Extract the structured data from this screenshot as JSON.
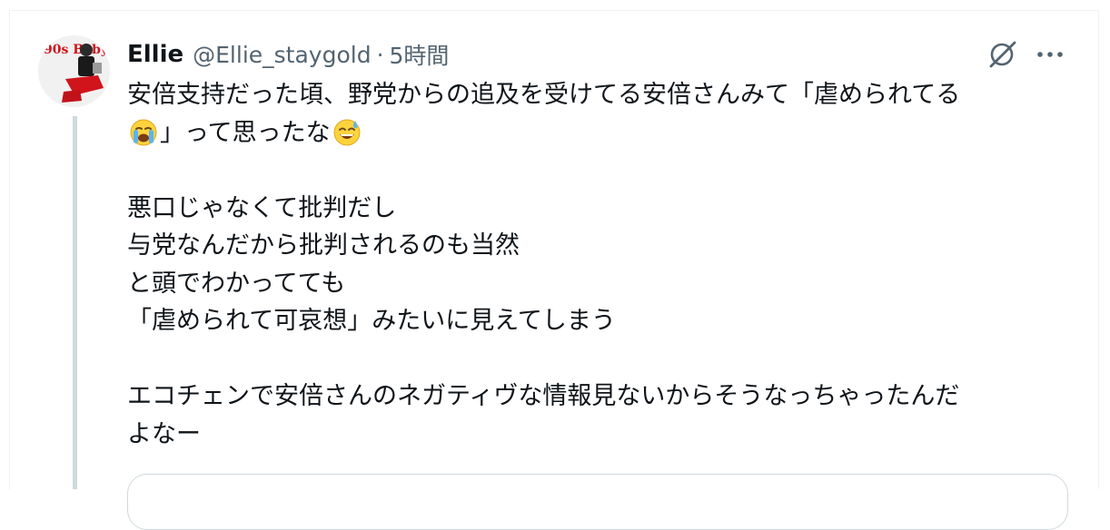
{
  "tweet": {
    "avatar_label": "90s Baby",
    "author_name": "Ellie",
    "handle": "@Ellie_staygold",
    "separator": "·",
    "time": "5時間",
    "line1": "安倍支持だった頃、野党からの追及を受けてる安倍さんみて「虐められてる",
    "line2": "」って思ったな",
    "line3": "悪口じゃなくて批判だし",
    "line4": "与党なんだから批判されるのも当然",
    "line5": "と頭でわかってても",
    "line6": "「虐められて可哀想」みたいに見えてしまう",
    "line7": "エコチェンで安倍さんのネガティヴな情報見ないからそうなっちゃったんだ",
    "line8": "よなー"
  },
  "icons": {
    "grok": "grok-icon",
    "more": "more-icon",
    "crying": "loudly-crying-face-emoji",
    "sweat": "grinning-sweat-emoji"
  },
  "colors": {
    "text": "#0f1419",
    "secondary": "#536471",
    "thread_line": "#cfd9de"
  }
}
